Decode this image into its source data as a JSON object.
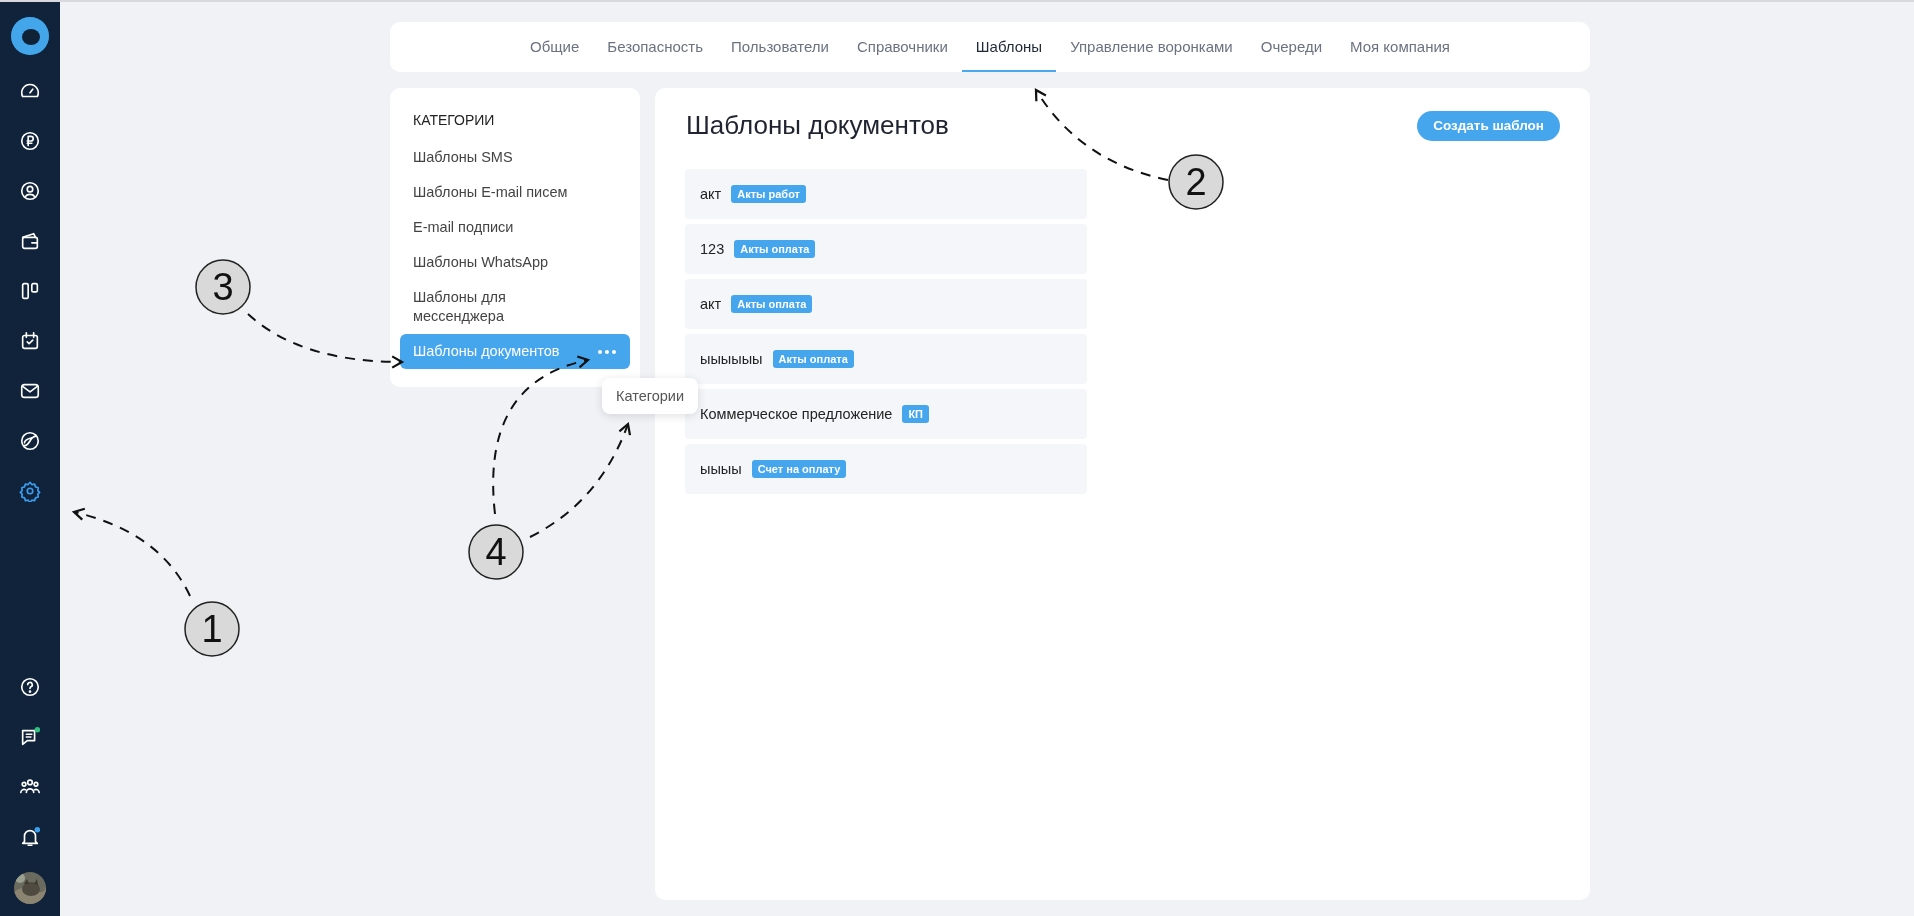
{
  "sidebar": {
    "items": [
      {
        "selected": false
      },
      {
        "selected": false
      },
      {
        "selected": false
      },
      {
        "selected": false
      },
      {
        "selected": false
      },
      {
        "selected": false
      },
      {
        "selected": false
      },
      {
        "selected": false
      },
      {
        "selected": true
      }
    ],
    "bottom_items": [
      {
        "selected": false
      },
      {
        "selected": false,
        "color": "#2ec27e"
      },
      {
        "selected": false
      },
      {
        "selected": false,
        "color": "#3aa0f0"
      }
    ]
  },
  "tabs": [
    {
      "label": "Общие",
      "selected": false
    },
    {
      "label": "Безопасность",
      "selected": false
    },
    {
      "label": "Пользователи",
      "selected": false
    },
    {
      "label": "Справочники",
      "selected": false
    },
    {
      "label": "Шаблоны",
      "selected": true
    },
    {
      "label": "Управление воронками",
      "selected": false
    },
    {
      "label": "Очереди",
      "selected": false
    },
    {
      "label": "Моя компания",
      "selected": false
    }
  ],
  "categories": {
    "heading": "КАТЕГОРИИ",
    "items": [
      {
        "label": "Шаблоны SMS",
        "selected": false
      },
      {
        "label": "Шаблоны E-mail писем",
        "selected": false
      },
      {
        "label": "E-mail подписи",
        "selected": false
      },
      {
        "label": "Шаблоны WhatsApp",
        "selected": false
      },
      {
        "label": "Шаблоны для мессенджера",
        "selected": false
      },
      {
        "label": "Шаблоны документов",
        "selected": true
      }
    ],
    "popup_menu": [
      "Категории"
    ]
  },
  "main": {
    "title": "Шаблоны документов",
    "create_button": "Создать шаблон",
    "rows": [
      {
        "name": "акт",
        "tag": "Акты работ"
      },
      {
        "name": "123",
        "tag": "Акты оплата"
      },
      {
        "name": "акт",
        "tag": "Акты оплата"
      },
      {
        "name": "ыыыыыы",
        "tag": "Акты оплата"
      },
      {
        "name": "Коммерческое предложение",
        "tag": "КП"
      },
      {
        "name": "ыыыы",
        "tag": "Счет на оплату"
      }
    ]
  },
  "annotations": [
    {
      "label": "1"
    },
    {
      "label": "2"
    },
    {
      "label": "3"
    },
    {
      "label": "4"
    }
  ]
}
